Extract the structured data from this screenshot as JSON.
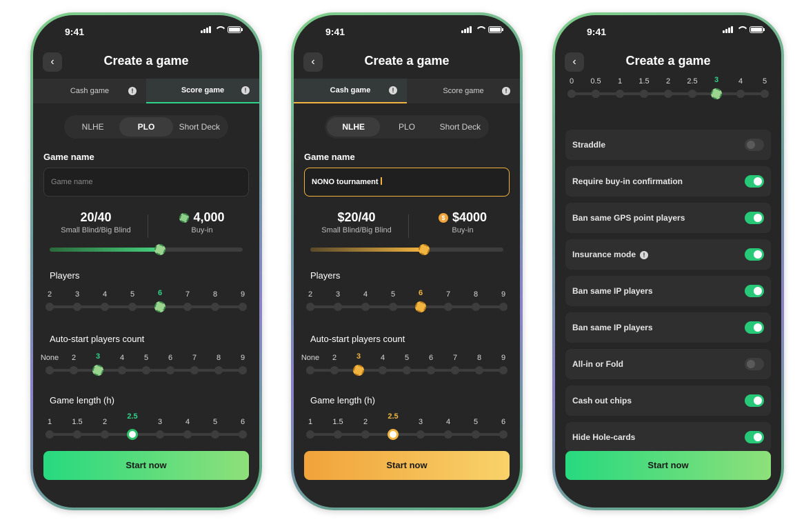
{
  "status_time": "9:41",
  "header_title": "Create a game",
  "screens": [
    {
      "tabs": [
        "Cash game",
        "Score game"
      ],
      "active_tab": 1,
      "variants": [
        "NLHE",
        "PLO",
        "Short Deck"
      ],
      "active_variant": 1,
      "game_name_label": "Game name",
      "game_name_placeholder": "Game name",
      "game_name_value": "",
      "blinds_value": "20/40",
      "blinds_label": "Small Blind/Big Blind",
      "buyin_value": "4,000",
      "buyin_label": "Buy-in",
      "blind_slider_fraction": 0.57,
      "players_label": "Players",
      "players_options": [
        "2",
        "3",
        "4",
        "5",
        "6",
        "7",
        "8",
        "9"
      ],
      "players_selected": "6",
      "autostart_label": "Auto-start players count",
      "autostart_options": [
        "None",
        "2",
        "3",
        "4",
        "5",
        "6",
        "7",
        "8",
        "9"
      ],
      "autostart_selected": "3",
      "length_label": "Game length (h)",
      "length_options": [
        "1",
        "1.5",
        "2",
        "2.5",
        "3",
        "4",
        "5",
        "6"
      ],
      "length_selected": "2.5",
      "cta": "Start now",
      "accent": "#2fd38a"
    },
    {
      "tabs": [
        "Cash game",
        "Score game"
      ],
      "active_tab": 0,
      "variants": [
        "NLHE",
        "PLO",
        "Short Deck"
      ],
      "active_variant": 0,
      "game_name_label": "Game name",
      "game_name_placeholder": "Game name",
      "game_name_value": "NONO tournament",
      "blinds_value": "$20/40",
      "blinds_label": "Small Blind/Big Blind",
      "buyin_value": "$4000",
      "buyin_label": "Buy-in",
      "buyin_chip": "$",
      "blind_slider_fraction": 0.59,
      "players_label": "Players",
      "players_options": [
        "2",
        "3",
        "4",
        "5",
        "6",
        "7",
        "8",
        "9"
      ],
      "players_selected": "6",
      "autostart_label": "Auto-start players count",
      "autostart_options": [
        "None",
        "2",
        "3",
        "4",
        "5",
        "6",
        "7",
        "8",
        "9"
      ],
      "autostart_selected": "3",
      "length_label": "Game length (h)",
      "length_options": [
        "1",
        "1.5",
        "2",
        "2.5",
        "3",
        "4",
        "5",
        "6"
      ],
      "length_selected": "2.5",
      "cta": "Start now",
      "accent": "#f2b440"
    }
  ],
  "settings_screen": {
    "scale_options": [
      "0",
      "0.5",
      "1",
      "1.5",
      "2",
      "2.5",
      "3",
      "4",
      "5"
    ],
    "scale_selected": "3",
    "toggles": [
      {
        "label": "Straddle",
        "on": false,
        "info": false
      },
      {
        "label": "Require buy-in confirmation",
        "on": true,
        "info": false
      },
      {
        "label": "Ban same GPS point players",
        "on": true,
        "info": false
      },
      {
        "label": "Insurance mode",
        "on": true,
        "info": true
      },
      {
        "label": "Ban same IP players",
        "on": true,
        "info": false
      },
      {
        "label": "Ban same IP players",
        "on": true,
        "info": false
      },
      {
        "label": "All-in or Fold",
        "on": false,
        "info": false
      },
      {
        "label": "Cash out chips",
        "on": true,
        "info": false
      },
      {
        "label": "Hide Hole-cards",
        "on": true,
        "info": false
      }
    ],
    "cta": "Start now"
  },
  "icons": {
    "back": "chevron-left-icon",
    "info": "info-icon",
    "chip": "chip-icon",
    "clock": "clock-icon"
  }
}
